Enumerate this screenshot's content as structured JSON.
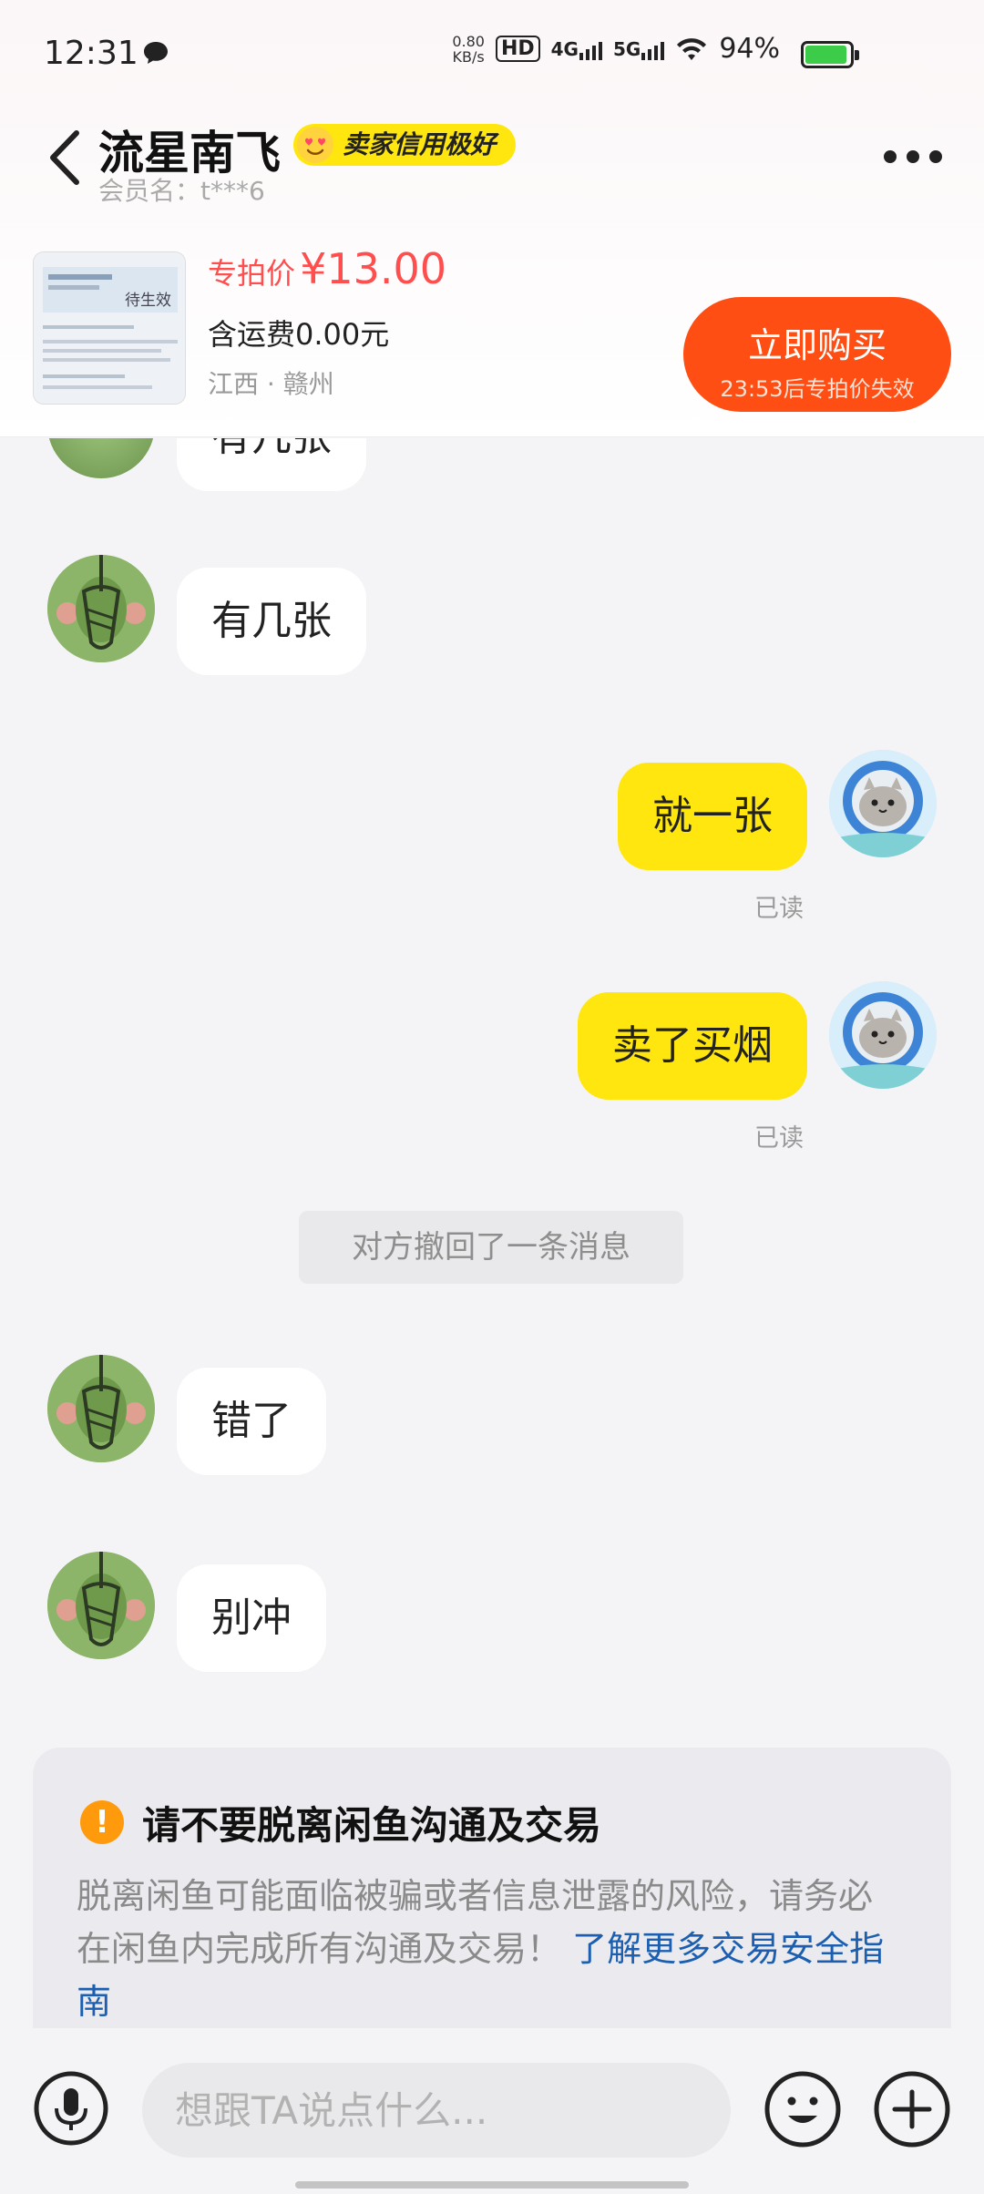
{
  "status_bar": {
    "time": "12:31",
    "net_speed_value": "0.80",
    "net_speed_unit": "KB/s",
    "hd_badge": "HD",
    "network_4g": "4G",
    "network_5g": "5G",
    "battery": "94%",
    "battery_level": 0.94
  },
  "header": {
    "contact_name": "流星南飞",
    "credit_badge": "卖家信用极好",
    "member_label": "会员名：t***6"
  },
  "product": {
    "price_label": "专拍价",
    "price_value": "¥13.00",
    "shipping": "含运费0.00元",
    "location": "江西 · 赣州",
    "thumb_stamp": "待生效",
    "buy_label": "立即购买",
    "buy_sub": "23:53后专拍价失效"
  },
  "messages": {
    "partial": "有几张",
    "m1": "有几张",
    "m2": "就一张",
    "m2_status": "已读",
    "m3": "卖了买烟",
    "m3_status": "已读",
    "recalled": "对方撤回了一条消息",
    "m4": "错了",
    "m5": "别冲"
  },
  "warning": {
    "title": "请不要脱离闲鱼沟通及交易",
    "body": "脱离闲鱼可能面临被骗或者信息泄露的风险，请务必在闲鱼内完成所有沟通及交易！",
    "link": "了解更多交易安全指南"
  },
  "input": {
    "placeholder": "想跟TA说点什么..."
  },
  "colors": {
    "accent_yellow": "#ffe60f",
    "buy_orange": "#ff4e13",
    "price_red": "#ff4e4e",
    "link_blue": "#1c5fb0"
  }
}
